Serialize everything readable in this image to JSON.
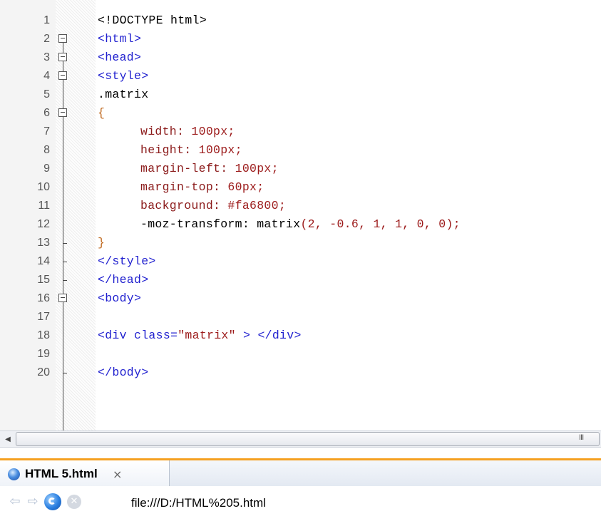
{
  "editor": {
    "lines": [
      {
        "num": "1"
      },
      {
        "num": "2"
      },
      {
        "num": "3"
      },
      {
        "num": "4"
      },
      {
        "num": "5"
      },
      {
        "num": "6"
      },
      {
        "num": "7"
      },
      {
        "num": "8"
      },
      {
        "num": "9"
      },
      {
        "num": "10"
      },
      {
        "num": "11"
      },
      {
        "num": "12"
      },
      {
        "num": "13"
      },
      {
        "num": "14"
      },
      {
        "num": "15"
      },
      {
        "num": "16"
      },
      {
        "num": "17"
      },
      {
        "num": "18"
      },
      {
        "num": "19"
      },
      {
        "num": "20"
      }
    ],
    "code": {
      "l1": "<!DOCTYPE html>",
      "l2": "<html>",
      "l3": "<head>",
      "l4": "<style>",
      "l5": ".matrix",
      "l6": "{",
      "l7_prop": "width:",
      "l7_val": "100px;",
      "l8_prop": "height:",
      "l8_val": "100px;",
      "l9_prop": "margin-left:",
      "l9_val": "100px;",
      "l10_prop": "margin-top:",
      "l10_val": "60px;",
      "l11_prop": "background:",
      "l11_val": "#fa6800;",
      "l12_prop": "-moz-transform:",
      "l12_fn": "matrix",
      "l12_args": "(2, -0.6, 1, 1, 0, 0);",
      "l13": "}",
      "l14": "</style>",
      "l15": "</head>",
      "l16": "<body>",
      "l18_open": "<div class=",
      "l18_attr": "\"matrix\"",
      "l18_close": " > </div>",
      "l20": "</body>"
    }
  },
  "scrollbar": {
    "grip": "III"
  },
  "browser": {
    "tab_title": "HTML 5.html",
    "tab_close": "×",
    "url": "file:///D:/HTML%205.html",
    "icons": {
      "back": "back-arrow-icon",
      "forward": "forward-arrow-icon",
      "reload": "reload-icon",
      "stop": "stop-icon",
      "tab": "globe-icon"
    },
    "colors": {
      "tab_accent": "#f5a020",
      "code_tag": "#1f1fcf",
      "code_property": "#8b1a1a",
      "code_brace": "#c06a20"
    }
  }
}
